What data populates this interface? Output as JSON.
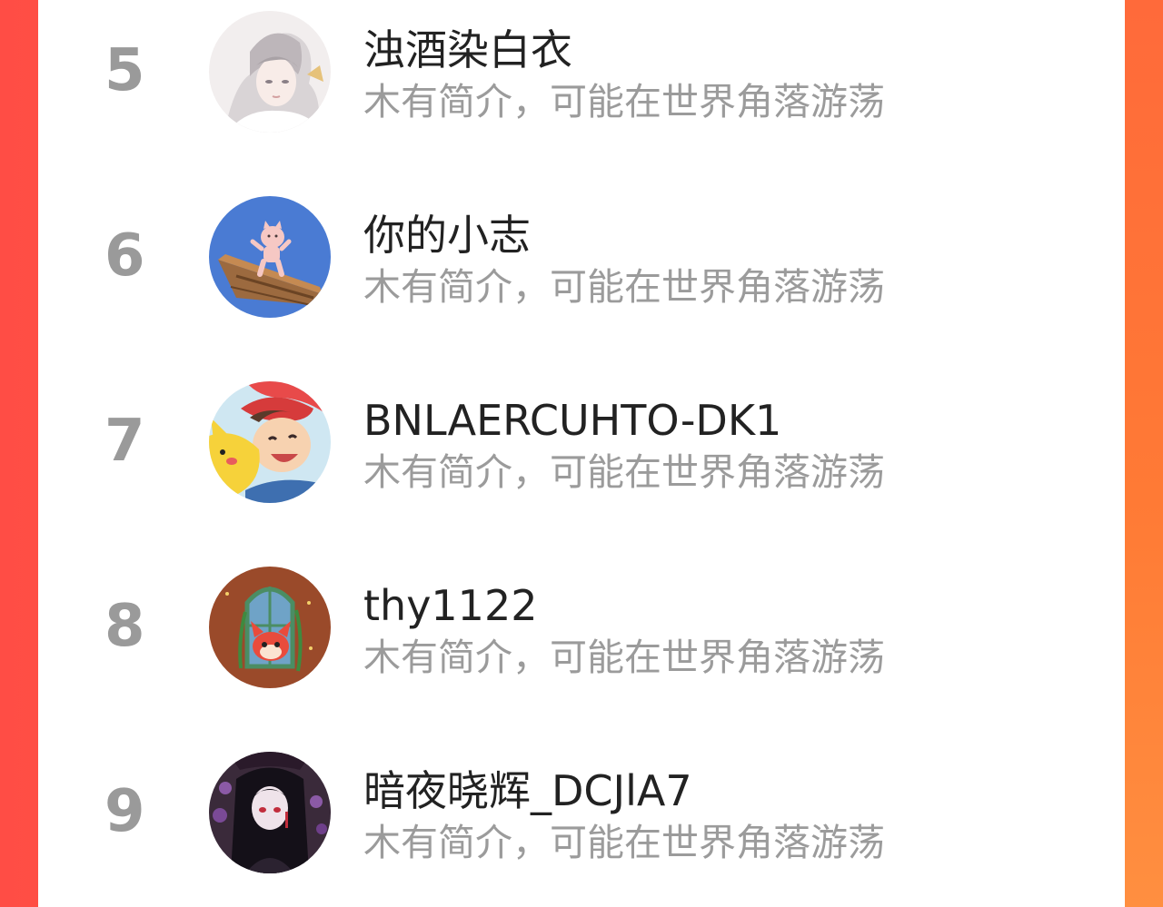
{
  "theme": {
    "accent_left": "#ff4d45",
    "accent_right": "#ff7a2f",
    "rank_color": "#9a9a9a",
    "name_color": "#222222",
    "bio_color": "#9b9b9b"
  },
  "ranking": [
    {
      "rank": "5",
      "name": "浊酒染白衣",
      "bio": "木有简介，可能在世界角落游荡",
      "avatar_icon": "anime-boy-avatar"
    },
    {
      "rank": "6",
      "name": "你的小志",
      "bio": "木有简介，可能在世界角落游荡",
      "avatar_icon": "cat-on-boat-avatar"
    },
    {
      "rank": "7",
      "name": "BNLAERCUHTO-DK1",
      "bio": "木有简介，可能在世界角落游荡",
      "avatar_icon": "boy-with-pikachu-avatar"
    },
    {
      "rank": "8",
      "name": "thy1122",
      "bio": "木有简介，可能在世界角落游荡",
      "avatar_icon": "fox-window-avatar"
    },
    {
      "rank": "9",
      "name": "暗夜晓辉_DCJlA7",
      "bio": "木有简介，可能在世界角落游荡",
      "avatar_icon": "dark-girl-avatar"
    }
  ]
}
